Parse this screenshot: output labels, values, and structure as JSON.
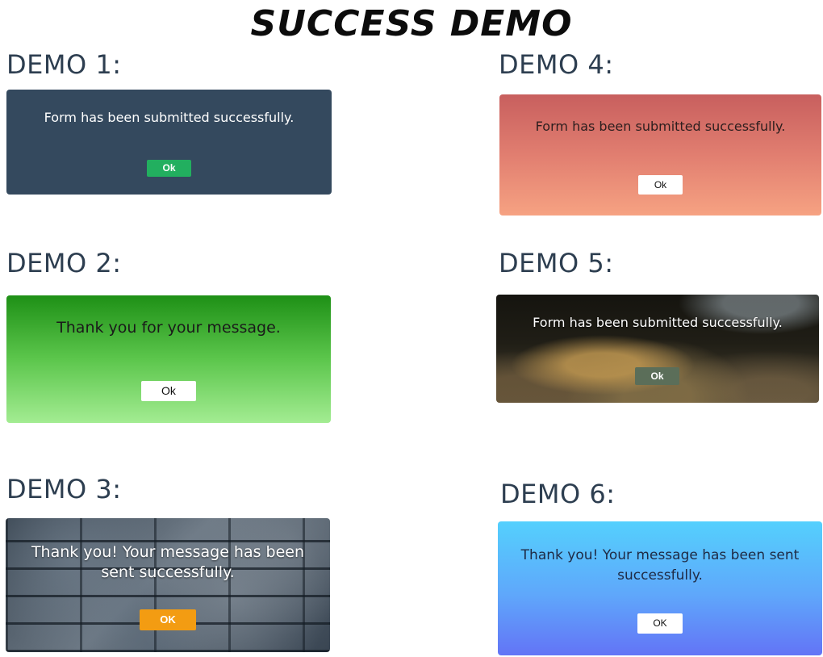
{
  "page": {
    "title": "SUCCESS DEMO"
  },
  "demos": [
    {
      "label": "DEMO 1:",
      "message": "Form has been submitted successfully.",
      "button": "Ok",
      "button_color": "#22af5f",
      "panel_color": "#34495e"
    },
    {
      "label": "DEMO 2:",
      "message": "Thank you for your message.",
      "button": "Ok",
      "button_color": "#ffffff"
    },
    {
      "label": "DEMO 3:",
      "message_line1": "Thank you! Your message has been",
      "message_line2": "sent successfully.",
      "button": "OK",
      "button_color": "#f39c12"
    },
    {
      "label": "DEMO 4:",
      "message": "Form has been submitted successfully.",
      "button": "Ok",
      "button_color": "#ffffff"
    },
    {
      "label": "DEMO 5:",
      "message": "Form has been submitted successfully.",
      "button": "Ok",
      "button_color": "#5b6e59"
    },
    {
      "label": "DEMO 6:",
      "message_line1": "Thank you! Your message has been sent",
      "message_line2": "successfully.",
      "button": "OK",
      "button_color": "#ffffff"
    }
  ]
}
